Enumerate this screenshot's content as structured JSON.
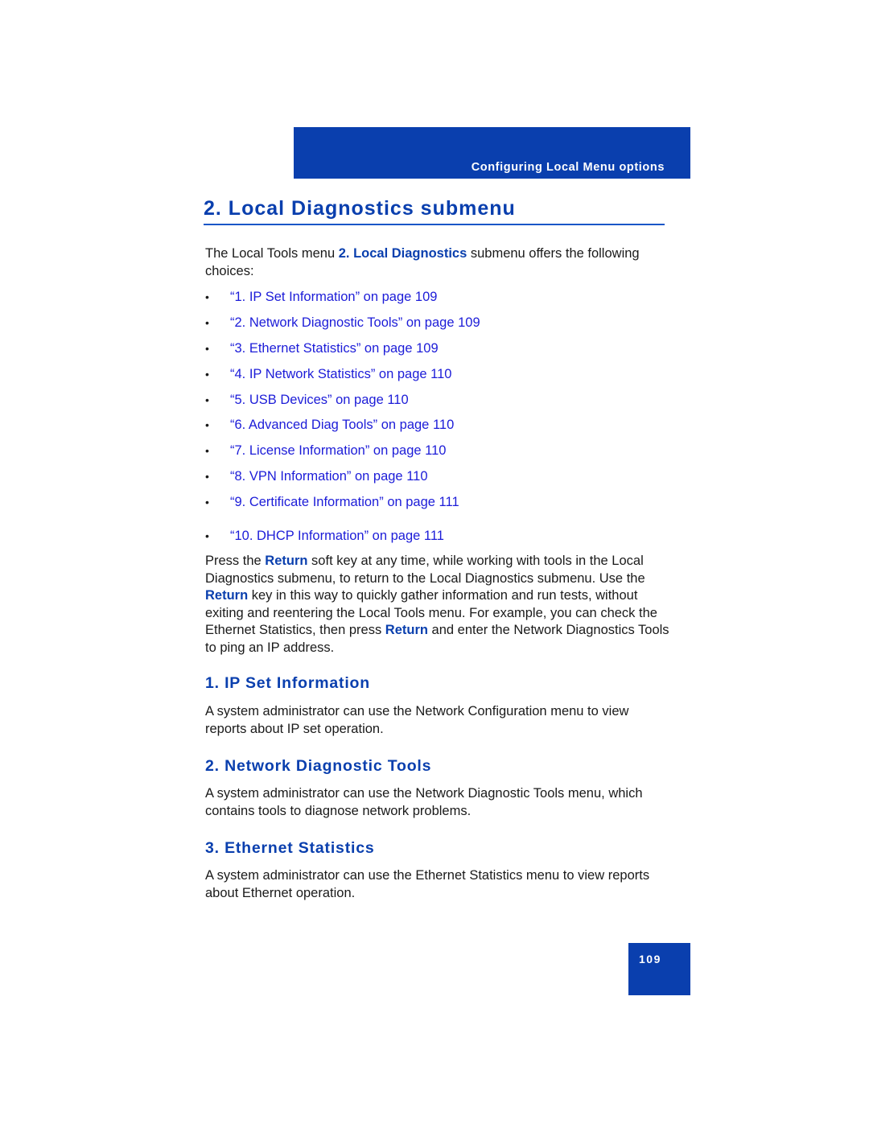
{
  "header": {
    "section_label": "Configuring Local Menu options"
  },
  "title": "2. Local Diagnostics submenu",
  "intro": {
    "before": "The Local Tools menu ",
    "emphasis": "2. Local Diagnostics",
    "after": " submenu offers the following choices:"
  },
  "choices": [
    {
      "bullet": "•",
      "label": "“1. IP Set Information” on page 109"
    },
    {
      "bullet": "•",
      "label": "“2. Network Diagnostic Tools” on page 109"
    },
    {
      "bullet": "•",
      "label": "“3. Ethernet Statistics” on page 109"
    },
    {
      "bullet": "•",
      "label": "“4. IP Network Statistics” on page 110"
    },
    {
      "bullet": "•",
      "label": "“5. USB Devices” on page 110"
    },
    {
      "bullet": "•",
      "label": "“6. Advanced Diag Tools” on page 110"
    },
    {
      "bullet": "•",
      "label": "“7. License Information” on page 110"
    },
    {
      "bullet": "•",
      "label": "“8. VPN Information” on page 110"
    },
    {
      "bullet": "•",
      "label": "“9. Certificate Information” on page 111"
    },
    {
      "bullet": "•",
      "label": "“10. DHCP Information” on page 111"
    }
  ],
  "return_paragraph": {
    "p1": "Press the ",
    "k1": "Return",
    "p2": " soft key at any time, while working with tools in the Local Diagnostics submenu, to return to the Local Diagnostics submenu. Use the ",
    "k2": "Return",
    "p3": " key in this way to quickly gather information and run tests, without exiting and reentering the Local Tools menu. For example, you can check the Ethernet Statistics, then press ",
    "k3": "Return",
    "p4": " and enter the Network Diagnostics Tools to ping an IP address."
  },
  "sections": [
    {
      "heading": "1. IP Set Information",
      "text": "A system administrator can use the Network Configuration menu to view reports about IP set operation."
    },
    {
      "heading": "2. Network Diagnostic Tools",
      "text": "A system administrator can use the Network Diagnostic Tools menu, which contains tools to diagnose network problems."
    },
    {
      "heading": "3. Ethernet Statistics",
      "text": "A system administrator can use the Ethernet Statistics menu to view reports about Ethernet operation."
    }
  ],
  "page_number": "109"
}
